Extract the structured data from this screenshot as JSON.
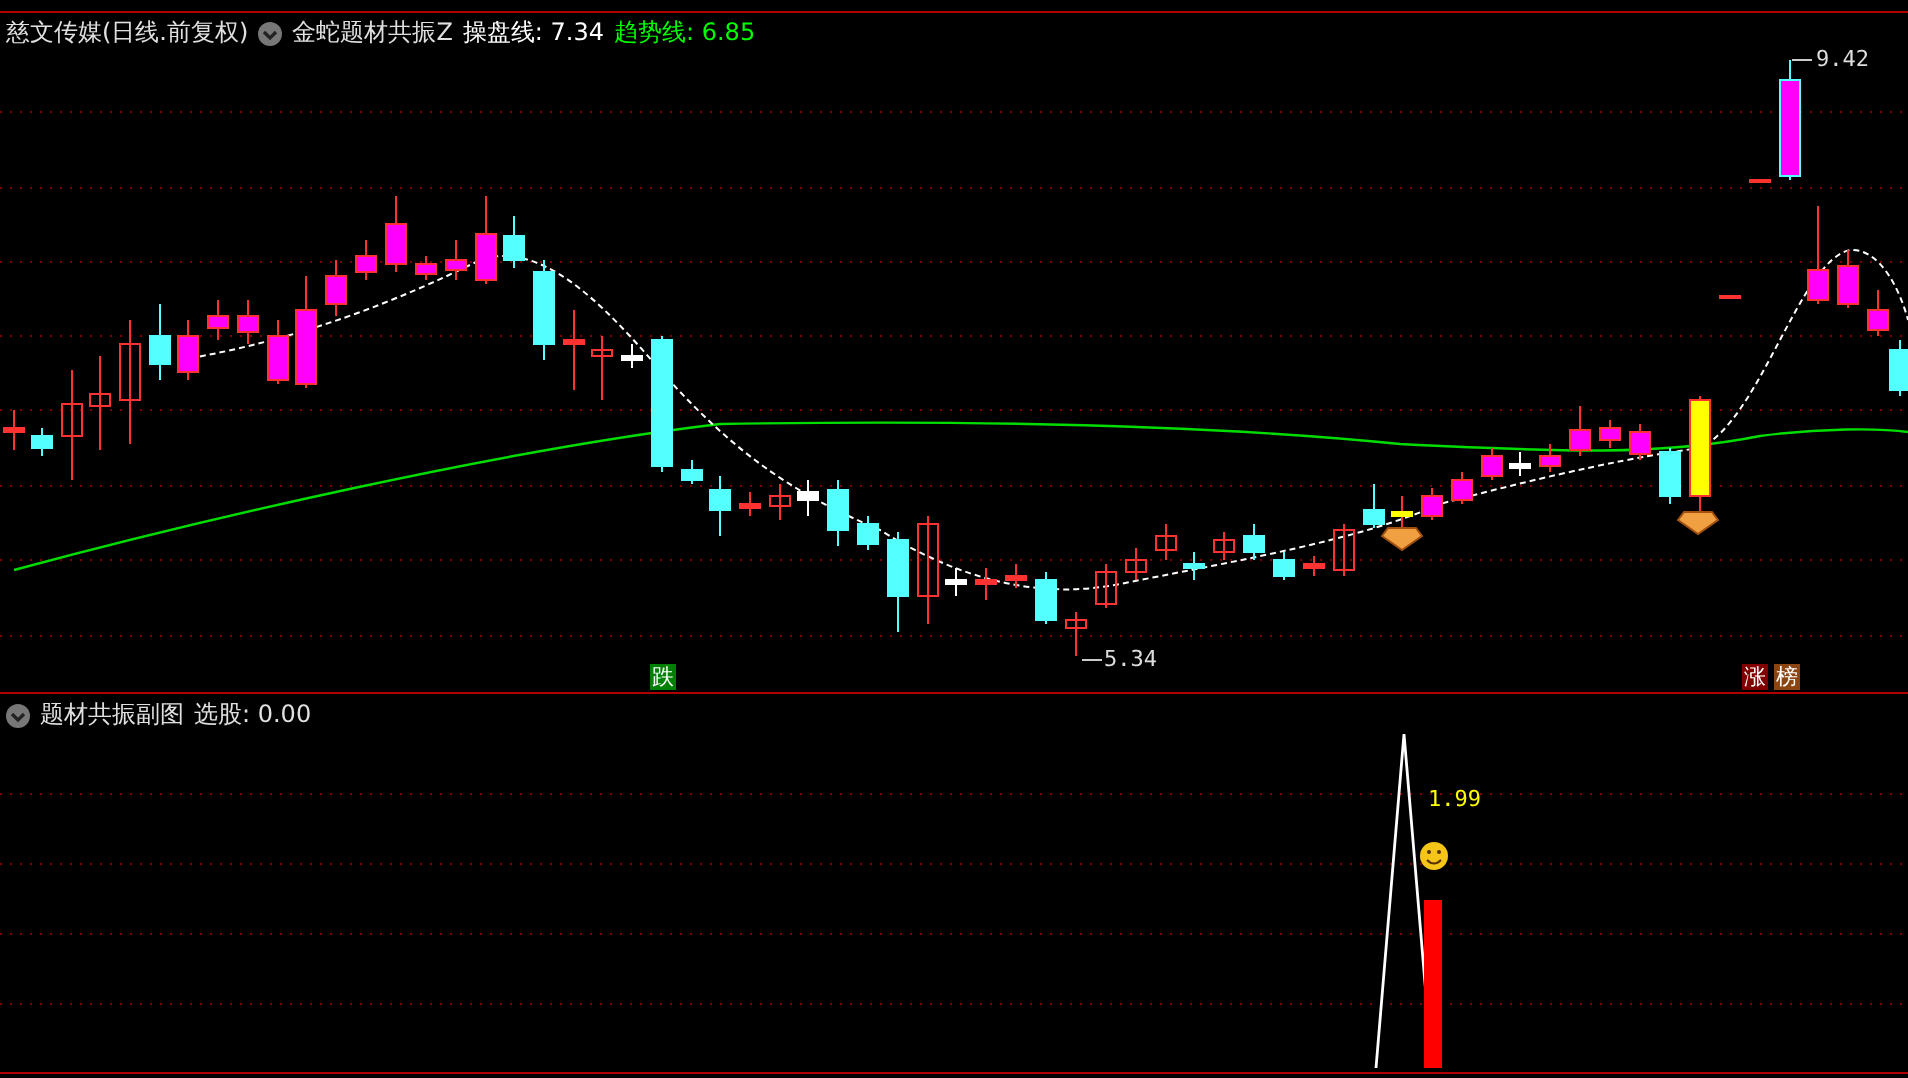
{
  "main_pane": {
    "stock": "慈文传媒(日线.前复权)",
    "indicator": "金蛇题材共振Z",
    "readouts": [
      {
        "label": "操盘线: 7.34",
        "color": "#ffffff"
      },
      {
        "label": "趋势线: 6.85",
        "color": "#00ff00"
      }
    ],
    "high_label": "9.42",
    "low_label": "5.34",
    "signals": [
      {
        "text": "跌",
        "color": "#008000"
      },
      {
        "text": "涨",
        "color": "#800000"
      },
      {
        "text": "榜",
        "color": "#8b4513"
      }
    ]
  },
  "sub_pane": {
    "title": "题材共振副图",
    "readouts": [
      {
        "label": "选股: 0.00"
      }
    ],
    "value_label": "1.99"
  }
}
